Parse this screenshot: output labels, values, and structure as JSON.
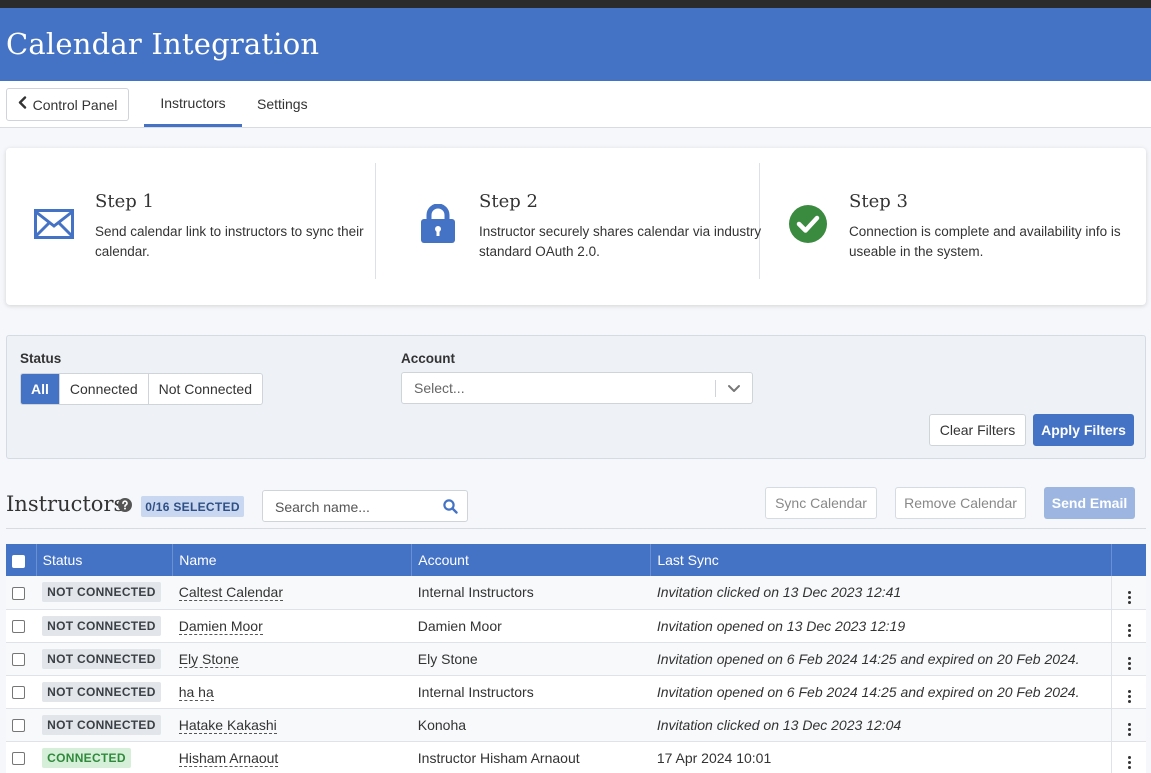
{
  "header": {
    "title": "Calendar Integration"
  },
  "nav": {
    "back_label": "Control Panel",
    "tabs": [
      {
        "label": "Instructors",
        "active": true
      },
      {
        "label": "Settings",
        "active": false
      }
    ]
  },
  "steps": [
    {
      "title": "Step 1",
      "text": "Send calendar link to instructors to sync their calendar.",
      "icon": "envelope-icon"
    },
    {
      "title": "Step 2",
      "text": "Instructor securely shares calendar via industry standard OAuth 2.0.",
      "icon": "lock-icon"
    },
    {
      "title": "Step 3",
      "text": "Connection is complete and availability info is useable in the system.",
      "icon": "check-circle-icon"
    }
  ],
  "filters": {
    "status_label": "Status",
    "status_options": [
      "All",
      "Connected",
      "Not Connected"
    ],
    "status_selected": "All",
    "account_label": "Account",
    "account_placeholder": "Select...",
    "clear_label": "Clear Filters",
    "apply_label": "Apply Filters"
  },
  "instructors": {
    "title": "Instructors",
    "selected_badge": "0/16 SELECTED",
    "search_placeholder": "Search name...",
    "sync_label": "Sync Calendar",
    "remove_label": "Remove Calendar",
    "send_label": "Send Email"
  },
  "table": {
    "columns": [
      "Status",
      "Name",
      "Account",
      "Last Sync"
    ],
    "rows": [
      {
        "status": "NOT CONNECTED",
        "name": "Caltest Calendar",
        "account": "Internal Instructors",
        "last_sync": "Invitation clicked on 13 Dec 2023 12:41"
      },
      {
        "status": "NOT CONNECTED",
        "name": "Damien Moor",
        "account": "Damien Moor",
        "last_sync": "Invitation opened on 13 Dec 2023 12:19"
      },
      {
        "status": "NOT CONNECTED",
        "name": "Ely Stone",
        "account": "Ely Stone",
        "last_sync": "Invitation opened on 6 Feb 2024 14:25 and expired on 20 Feb 2024."
      },
      {
        "status": "NOT CONNECTED",
        "name": "ha ha",
        "account": "Internal Instructors",
        "last_sync": "Invitation opened on 6 Feb 2024 14:25 and expired on 20 Feb 2024."
      },
      {
        "status": "NOT CONNECTED",
        "name": "Hatake Kakashi",
        "account": "Konoha",
        "last_sync": "Invitation clicked on 13 Dec 2023 12:04"
      },
      {
        "status": "CONNECTED",
        "name": "Hisham Arnaout",
        "account": "Instructor Hisham Arnaout",
        "last_sync": "17 Apr 2024 10:01"
      }
    ]
  },
  "colors": {
    "primary": "#4472c4",
    "success": "#3a8a3f",
    "connected_badge_bg": "#d6efd8",
    "not_connected_badge_bg": "#e2e5e9"
  }
}
